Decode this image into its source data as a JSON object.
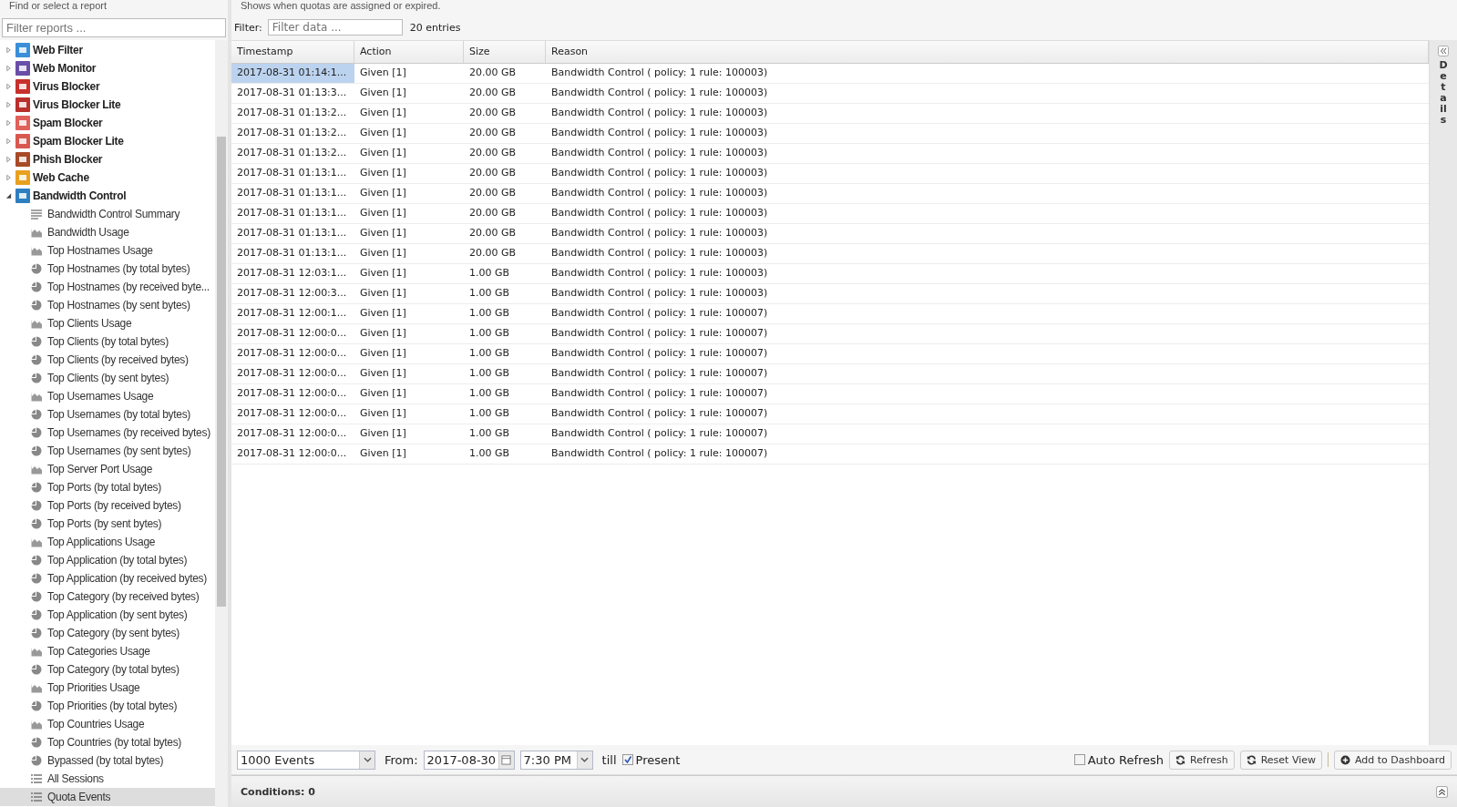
{
  "sidebar": {
    "title": "Find or select a report",
    "search": {
      "placeholder": "Filter reports ..."
    },
    "tree": [
      {
        "label": "Web Filter",
        "color": "#3a8fd8",
        "expanded": false,
        "selected": false
      },
      {
        "label": "Web Monitor",
        "color": "#6a4fa8",
        "expanded": false,
        "selected": false
      },
      {
        "label": "Virus Blocker",
        "color": "#c8302c",
        "expanded": false,
        "selected": false
      },
      {
        "label": "Virus Blocker Lite",
        "color": "#b8302c",
        "expanded": false,
        "selected": false
      },
      {
        "label": "Spam Blocker",
        "color": "#e0605a",
        "expanded": false,
        "selected": false
      },
      {
        "label": "Spam Blocker Lite",
        "color": "#d8584f",
        "expanded": false,
        "selected": false
      },
      {
        "label": "Phish Blocker",
        "color": "#a84a28",
        "expanded": false,
        "selected": false
      },
      {
        "label": "Web Cache",
        "color": "#e8a020",
        "expanded": false,
        "selected": false
      },
      {
        "label": "Bandwidth Control",
        "color": "#2f7fc0",
        "expanded": true,
        "selected": false,
        "children": [
          {
            "label": "Bandwidth Control Summary",
            "kind": "text",
            "selected": false
          },
          {
            "label": "Bandwidth Usage",
            "kind": "area",
            "selected": false
          },
          {
            "label": "Top Hostnames Usage",
            "kind": "area",
            "selected": false
          },
          {
            "label": "Top Hostnames (by total bytes)",
            "kind": "pie",
            "selected": false
          },
          {
            "label": "Top Hostnames (by received byte...",
            "kind": "pie",
            "selected": false
          },
          {
            "label": "Top Hostnames (by sent bytes)",
            "kind": "pie",
            "selected": false
          },
          {
            "label": "Top Clients Usage",
            "kind": "area",
            "selected": false
          },
          {
            "label": "Top Clients (by total bytes)",
            "kind": "pie",
            "selected": false
          },
          {
            "label": "Top Clients (by received bytes)",
            "kind": "pie",
            "selected": false
          },
          {
            "label": "Top Clients (by sent bytes)",
            "kind": "pie",
            "selected": false
          },
          {
            "label": "Top Usernames Usage",
            "kind": "area",
            "selected": false
          },
          {
            "label": "Top Usernames (by total bytes)",
            "kind": "pie",
            "selected": false
          },
          {
            "label": "Top Usernames (by received bytes)",
            "kind": "pie",
            "selected": false
          },
          {
            "label": "Top Usernames (by sent bytes)",
            "kind": "pie",
            "selected": false
          },
          {
            "label": "Top Server Port Usage",
            "kind": "area",
            "selected": false
          },
          {
            "label": "Top Ports (by total bytes)",
            "kind": "pie",
            "selected": false
          },
          {
            "label": "Top Ports (by received bytes)",
            "kind": "pie",
            "selected": false
          },
          {
            "label": "Top Ports (by sent bytes)",
            "kind": "pie",
            "selected": false
          },
          {
            "label": "Top Applications Usage",
            "kind": "area",
            "selected": false
          },
          {
            "label": "Top Application (by total bytes)",
            "kind": "pie",
            "selected": false
          },
          {
            "label": "Top Application (by received bytes)",
            "kind": "pie",
            "selected": false
          },
          {
            "label": "Top Category (by received bytes)",
            "kind": "pie",
            "selected": false
          },
          {
            "label": "Top Application (by sent bytes)",
            "kind": "pie",
            "selected": false
          },
          {
            "label": "Top Category (by sent bytes)",
            "kind": "pie",
            "selected": false
          },
          {
            "label": "Top Categories Usage",
            "kind": "area",
            "selected": false
          },
          {
            "label": "Top Category (by total bytes)",
            "kind": "pie",
            "selected": false
          },
          {
            "label": "Top Priorities Usage",
            "kind": "area",
            "selected": false
          },
          {
            "label": "Top Priorities (by total bytes)",
            "kind": "pie",
            "selected": false
          },
          {
            "label": "Top Countries Usage",
            "kind": "area",
            "selected": false
          },
          {
            "label": "Top Countries (by total bytes)",
            "kind": "pie",
            "selected": false
          },
          {
            "label": "Bypassed (by total bytes)",
            "kind": "pie",
            "selected": false
          },
          {
            "label": "All Sessions",
            "kind": "list",
            "selected": false
          },
          {
            "label": "Quota Events",
            "kind": "list",
            "selected": true
          }
        ]
      }
    ]
  },
  "report": {
    "description": "Shows when quotas are assigned or expired.",
    "filter_label": "Filter:",
    "filter": {
      "placeholder": "Filter data ..."
    },
    "entries": "20 entries",
    "table": {
      "columns": [
        "Timestamp",
        "Action",
        "Size",
        "Reason"
      ],
      "rows": [
        {
          "cells": [
            "2017-08-31 01:14:1...",
            "Given [1]",
            "20.00 GB",
            "Bandwidth Control ( policy: 1 rule: 100003)"
          ],
          "selected": true
        },
        {
          "cells": [
            "2017-08-31 01:13:3...",
            "Given [1]",
            "20.00 GB",
            "Bandwidth Control ( policy: 1 rule: 100003)"
          ],
          "selected": false
        },
        {
          "cells": [
            "2017-08-31 01:13:2...",
            "Given [1]",
            "20.00 GB",
            "Bandwidth Control ( policy: 1 rule: 100003)"
          ],
          "selected": false
        },
        {
          "cells": [
            "2017-08-31 01:13:2...",
            "Given [1]",
            "20.00 GB",
            "Bandwidth Control ( policy: 1 rule: 100003)"
          ],
          "selected": false
        },
        {
          "cells": [
            "2017-08-31 01:13:2...",
            "Given [1]",
            "20.00 GB",
            "Bandwidth Control ( policy: 1 rule: 100003)"
          ],
          "selected": false
        },
        {
          "cells": [
            "2017-08-31 01:13:1...",
            "Given [1]",
            "20.00 GB",
            "Bandwidth Control ( policy: 1 rule: 100003)"
          ],
          "selected": false
        },
        {
          "cells": [
            "2017-08-31 01:13:1...",
            "Given [1]",
            "20.00 GB",
            "Bandwidth Control ( policy: 1 rule: 100003)"
          ],
          "selected": false
        },
        {
          "cells": [
            "2017-08-31 01:13:1...",
            "Given [1]",
            "20.00 GB",
            "Bandwidth Control ( policy: 1 rule: 100003)"
          ],
          "selected": false
        },
        {
          "cells": [
            "2017-08-31 01:13:1...",
            "Given [1]",
            "20.00 GB",
            "Bandwidth Control ( policy: 1 rule: 100003)"
          ],
          "selected": false
        },
        {
          "cells": [
            "2017-08-31 01:13:1...",
            "Given [1]",
            "20.00 GB",
            "Bandwidth Control ( policy: 1 rule: 100003)"
          ],
          "selected": false
        },
        {
          "cells": [
            "2017-08-31 12:03:1...",
            "Given [1]",
            "1.00 GB",
            "Bandwidth Control ( policy: 1 rule: 100003)"
          ],
          "selected": false
        },
        {
          "cells": [
            "2017-08-31 12:00:3...",
            "Given [1]",
            "1.00 GB",
            "Bandwidth Control ( policy: 1 rule: 100003)"
          ],
          "selected": false
        },
        {
          "cells": [
            "2017-08-31 12:00:1...",
            "Given [1]",
            "1.00 GB",
            "Bandwidth Control ( policy: 1 rule: 100007)"
          ],
          "selected": false
        },
        {
          "cells": [
            "2017-08-31 12:00:0...",
            "Given [1]",
            "1.00 GB",
            "Bandwidth Control ( policy: 1 rule: 100007)"
          ],
          "selected": false
        },
        {
          "cells": [
            "2017-08-31 12:00:0...",
            "Given [1]",
            "1.00 GB",
            "Bandwidth Control ( policy: 1 rule: 100007)"
          ],
          "selected": false
        },
        {
          "cells": [
            "2017-08-31 12:00:0...",
            "Given [1]",
            "1.00 GB",
            "Bandwidth Control ( policy: 1 rule: 100007)"
          ],
          "selected": false
        },
        {
          "cells": [
            "2017-08-31 12:00:0...",
            "Given [1]",
            "1.00 GB",
            "Bandwidth Control ( policy: 1 rule: 100007)"
          ],
          "selected": false
        },
        {
          "cells": [
            "2017-08-31 12:00:0...",
            "Given [1]",
            "1.00 GB",
            "Bandwidth Control ( policy: 1 rule: 100007)"
          ],
          "selected": false
        },
        {
          "cells": [
            "2017-08-31 12:00:0...",
            "Given [1]",
            "1.00 GB",
            "Bandwidth Control ( policy: 1 rule: 100007)"
          ],
          "selected": false
        },
        {
          "cells": [
            "2017-08-31 12:00:0...",
            "Given [1]",
            "1.00 GB",
            "Bandwidth Control ( policy: 1 rule: 100007)"
          ],
          "selected": false
        }
      ]
    },
    "toolbar": {
      "limit": "1000 Events",
      "from_label": "From:",
      "date": "2017-08-30",
      "time": "7:30 PM",
      "till_label": "till",
      "present": {
        "label": "Present",
        "checked": true
      },
      "auto_refresh": {
        "label": "Auto Refresh",
        "checked": false
      },
      "buttons": [
        "Refresh",
        "Reset View",
        "Add to Dashboard"
      ]
    },
    "conditions": "Conditions: 0",
    "details_tab": "Details"
  }
}
